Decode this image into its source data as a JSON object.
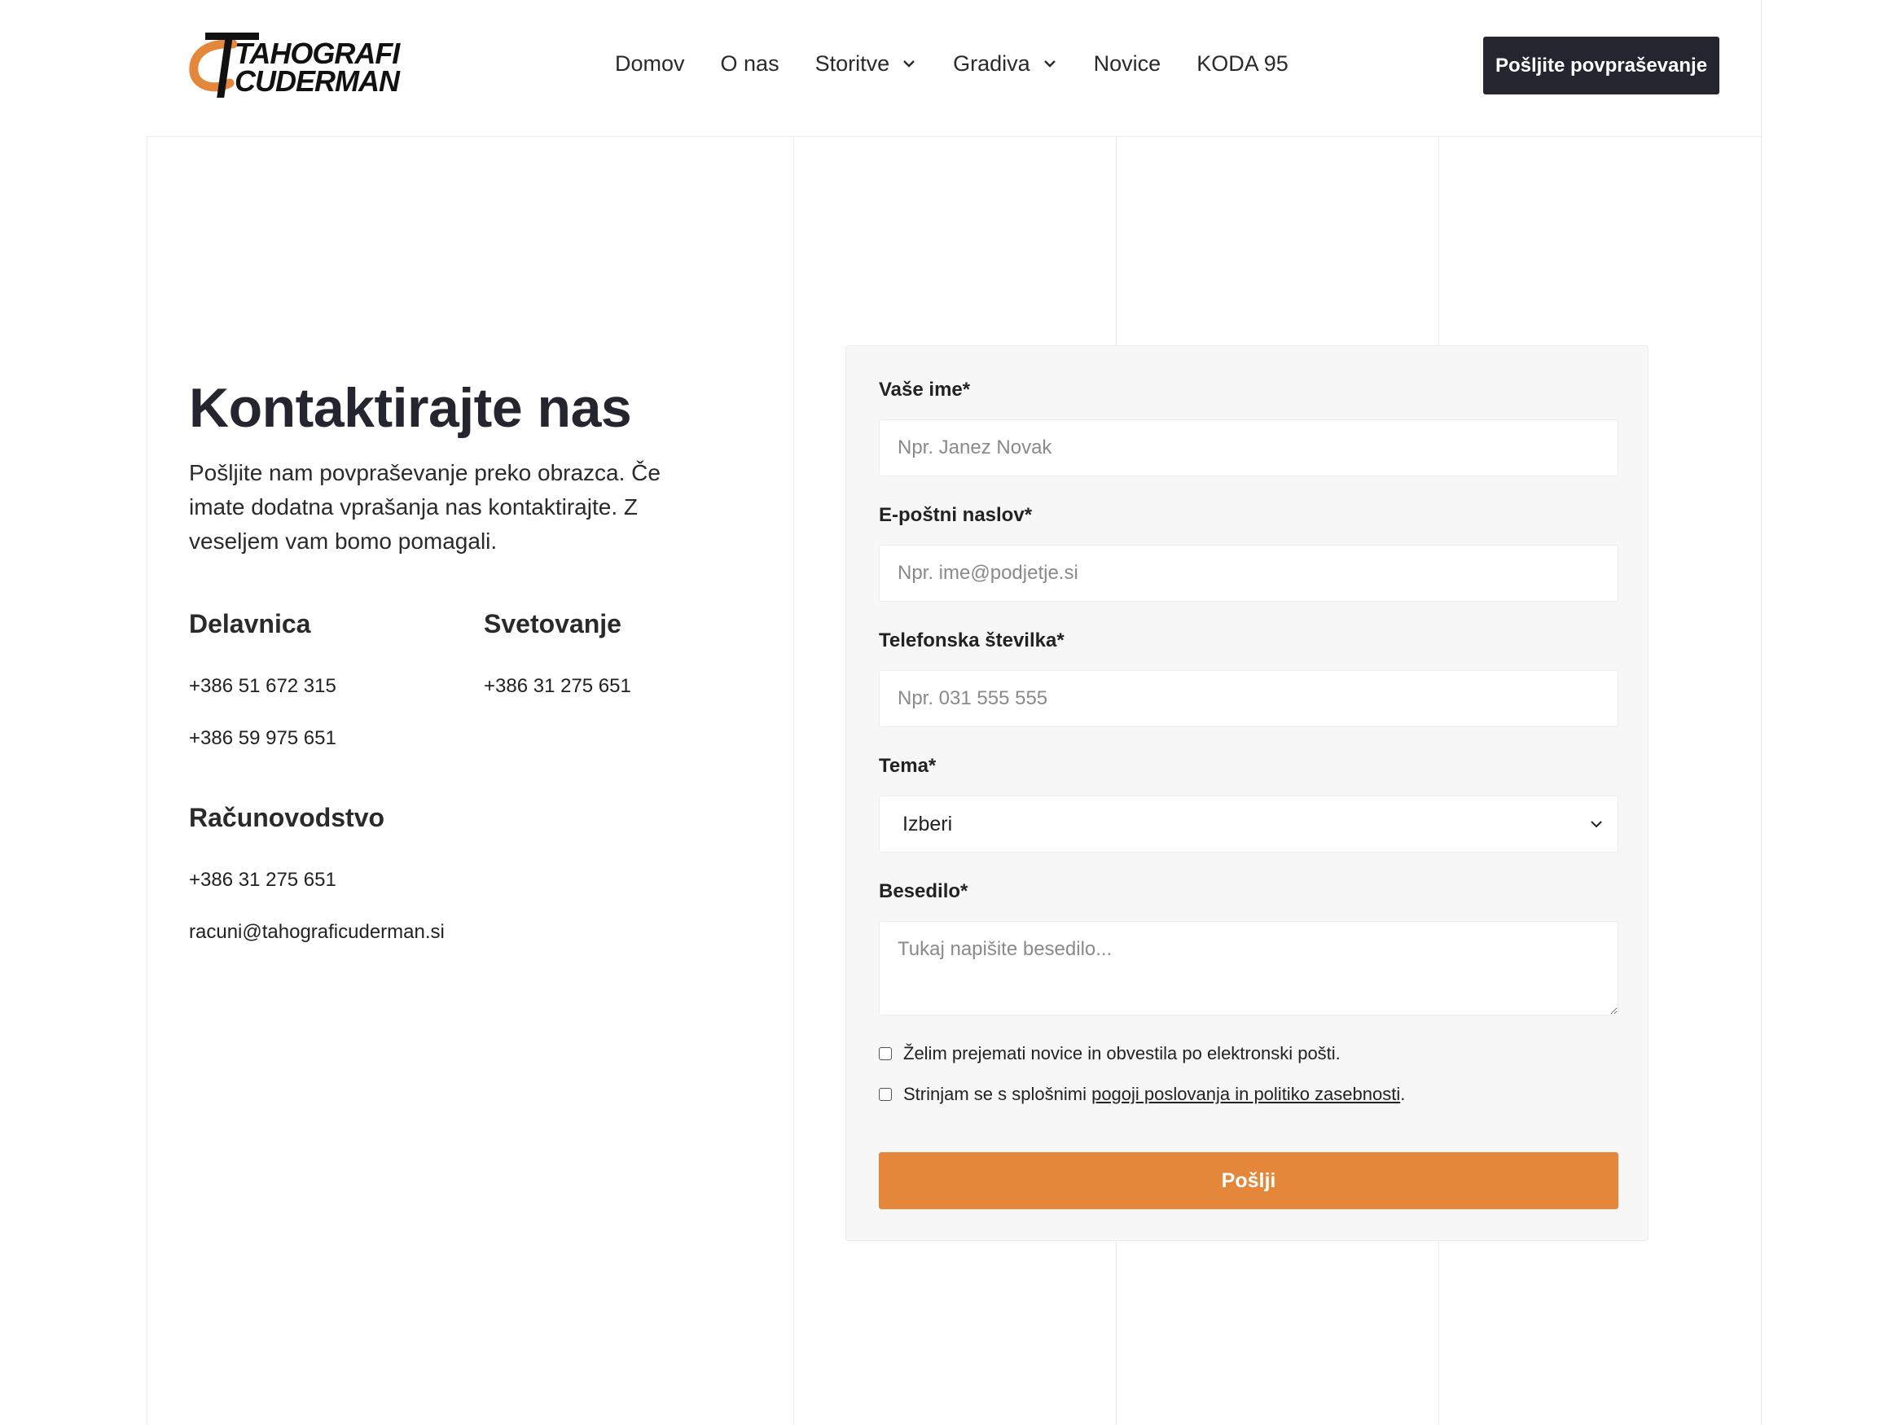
{
  "header": {
    "logo": {
      "line1": "TAHOGRAFI",
      "line2": "CUDERMAN"
    },
    "nav": [
      {
        "label": "Domov",
        "dropdown": false
      },
      {
        "label": "O nas",
        "dropdown": false
      },
      {
        "label": "Storitve",
        "dropdown": true
      },
      {
        "label": "Gradiva",
        "dropdown": true
      },
      {
        "label": "Novice",
        "dropdown": false
      },
      {
        "label": "KODA 95",
        "dropdown": false
      }
    ],
    "cta_label": "Pošljite povpraševanje"
  },
  "intro": {
    "title": "Kontaktirajte nas",
    "text": "Pošljite nam povpraševanje preko obrazca. Če imate dodatna vprašanja nas kontaktirajte. Z veseljem vam bomo pomagali."
  },
  "contacts": {
    "workshop": {
      "heading": "Delavnica",
      "lines": [
        "+386 51 672 315",
        "+386 59 975 651"
      ]
    },
    "consulting": {
      "heading": "Svetovanje",
      "lines": [
        "+386 31 275 651"
      ]
    },
    "accounting": {
      "heading": "Računovodstvo",
      "lines": [
        "+386 31 275 651",
        "racuni@tahograficuderman.si"
      ]
    }
  },
  "form": {
    "name": {
      "label": "Vaše ime*",
      "placeholder": "Npr. Janez Novak",
      "value": ""
    },
    "email": {
      "label": "E-poštni naslov*",
      "placeholder": "Npr. ime@podjetje.si",
      "value": ""
    },
    "phone": {
      "label": "Telefonska številka*",
      "placeholder": "Npr. 031 555 555",
      "value": ""
    },
    "topic": {
      "label": "Tema*",
      "selected": "Izberi"
    },
    "message": {
      "label": "Besedilo*",
      "placeholder": "Tukaj napišite besedilo...",
      "value": ""
    },
    "newsletter": {
      "text": "Želim prejemati novice in obvestila po elektronski pošti.",
      "checked": false
    },
    "terms": {
      "prefix": "Strinjam se s splošnimi ",
      "link": "pogoji poslovanja in politiko zasebnosti",
      "suffix": ".",
      "checked": false
    },
    "submit_label": "Pošlji"
  },
  "colors": {
    "accent": "#e5873b",
    "dark": "#24252f",
    "panel": "#f7f7f7",
    "border": "#ececec"
  },
  "icons": [
    "chevron-down-icon",
    "checkbox-icon"
  ]
}
